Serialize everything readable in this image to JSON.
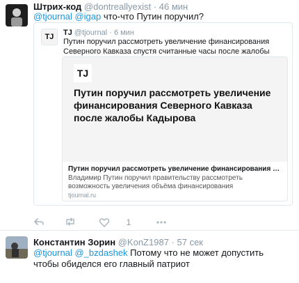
{
  "tweet1": {
    "name": "Штрих-код",
    "handle": "@dontreallyexist",
    "time": "· 46 мин",
    "text": "@tjournal @igap что-что Путин поручил?",
    "quote": {
      "logo": "TJ",
      "name": "TJ",
      "handle": "@tjournal",
      "time": "· 6 мин",
      "text": "Путин поручил рассмотреть увеличение финансирования Северного Кавказа спустя считанные часы после жалобы Кадырова",
      "card": {
        "image_logo": "TJ",
        "image_headline": "Путин поручил рассмотреть увеличение финансирования Северного Кавказа после жалобы Кадырова",
        "title": "Путин поручил рассмотреть увеличение финансирования Северного Кавказа после жалобы Кадырова",
        "description": "Владимир Путин поручил правительству рассмотреть возможность увеличения объёма финансирования государственной программы развития Северного Кавказа",
        "domain": "tjournal.ru"
      }
    },
    "actions": {
      "like_count": "1"
    }
  },
  "tweet2": {
    "name": "Константин Зорин",
    "handle": "@KonZ1987",
    "time": "· 57 сек",
    "text": "@tjournal @_bzdashek Потому что не может допустить чтобы обиделся его главный патриот"
  },
  "colors": {
    "link": "#1b95e0",
    "muted": "#8899a6",
    "border": "#e1e8ed"
  },
  "icons": [
    "reply-icon",
    "retweet-icon",
    "like-icon",
    "more-icon"
  ]
}
